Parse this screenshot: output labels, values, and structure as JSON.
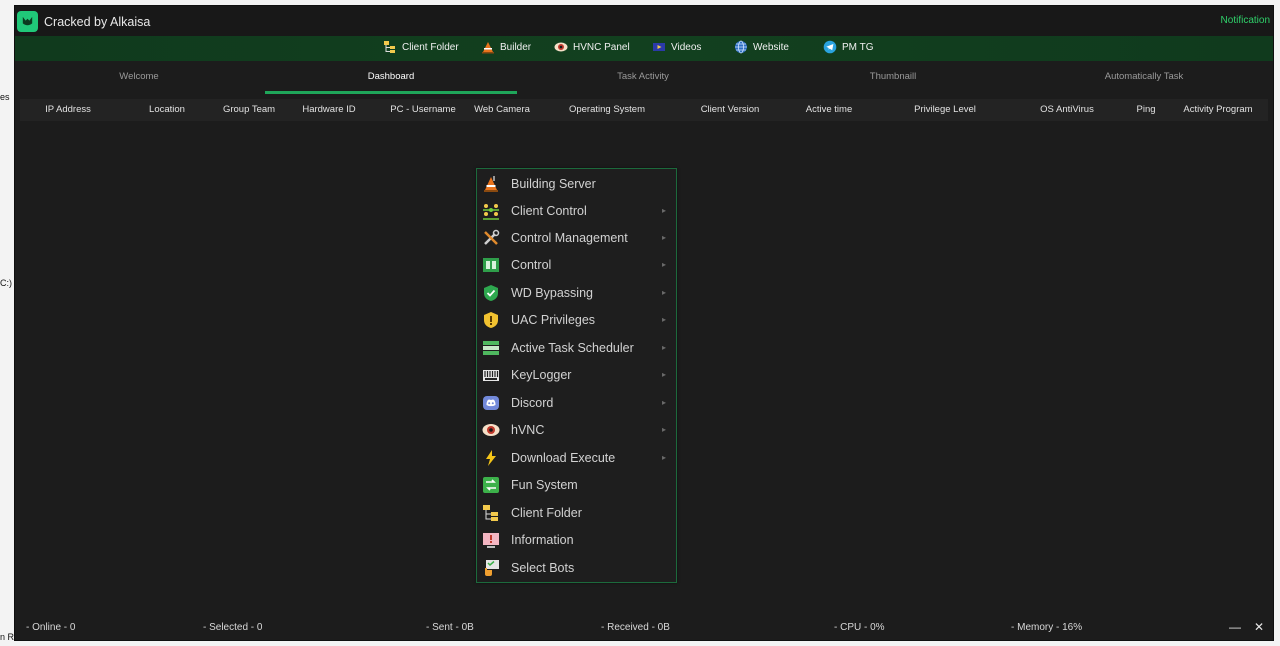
{
  "background": {
    "fragments": [
      "",
      "es",
      "C:)",
      "n R"
    ]
  },
  "window": {
    "title": "Cracked by Alkaisa",
    "notification": "Notification",
    "accent": "#1fa65a",
    "brand": "#20c879"
  },
  "toolbar": [
    {
      "label": "Client Folder",
      "icon": "folder-tree-icon"
    },
    {
      "label": "Builder",
      "icon": "construction-icon"
    },
    {
      "label": "HVNC Panel",
      "icon": "eye-icon"
    },
    {
      "label": "Videos",
      "icon": "video-icon"
    },
    {
      "label": "Website",
      "icon": "globe-icon"
    },
    {
      "label": "PM TG",
      "icon": "telegram-icon"
    }
  ],
  "tabs": [
    {
      "label": "Welcome"
    },
    {
      "label": "Dashboard",
      "active": true
    },
    {
      "label": "Task Activity"
    },
    {
      "label": "Thumbnaill"
    },
    {
      "label": "Automatically Task"
    }
  ],
  "columns": [
    "IP Address",
    "Location",
    "Group Team",
    "Hardware ID",
    "PC - Username",
    "Web Camera",
    "Operating System",
    "Client Version",
    "Active time",
    "Privilege Level",
    "OS AntiVirus",
    "Ping",
    "Activity Program"
  ],
  "context_menu": [
    {
      "label": "Building Server",
      "icon": "construction-icon",
      "submenu": false
    },
    {
      "label": "Client Control",
      "icon": "group-icon",
      "submenu": true
    },
    {
      "label": "Control Management",
      "icon": "tools-icon",
      "submenu": true
    },
    {
      "label": "Control",
      "icon": "chip-icon",
      "submenu": true
    },
    {
      "label": "WD Bypassing",
      "icon": "shield-check-icon",
      "submenu": true
    },
    {
      "label": "UAC Privileges",
      "icon": "shield-warning-icon",
      "submenu": true
    },
    {
      "label": "Active Task Scheduler",
      "icon": "scheduler-icon",
      "submenu": true
    },
    {
      "label": "KeyLogger",
      "icon": "keyboard-icon",
      "submenu": true
    },
    {
      "label": "Discord",
      "icon": "discord-icon",
      "submenu": true
    },
    {
      "label": "hVNC",
      "icon": "eye-icon",
      "submenu": true
    },
    {
      "label": "Download Execute",
      "icon": "lightning-icon",
      "submenu": true
    },
    {
      "label": "Fun System",
      "icon": "arrows-icon",
      "submenu": false
    },
    {
      "label": "Client Folder",
      "icon": "folder-tree-icon",
      "submenu": false
    },
    {
      "label": "Information",
      "icon": "info-icon",
      "submenu": false
    },
    {
      "label": "Select Bots",
      "icon": "hand-select-icon",
      "submenu": false
    }
  ],
  "status": {
    "online": "- Online - 0",
    "selected": "- Selected - 0",
    "sent": "- Sent - 0B",
    "received": "- Received -  0B",
    "cpu": "- CPU - 0%",
    "memory": "- Memory - 16%",
    "minimize": "—",
    "close": "✕"
  }
}
